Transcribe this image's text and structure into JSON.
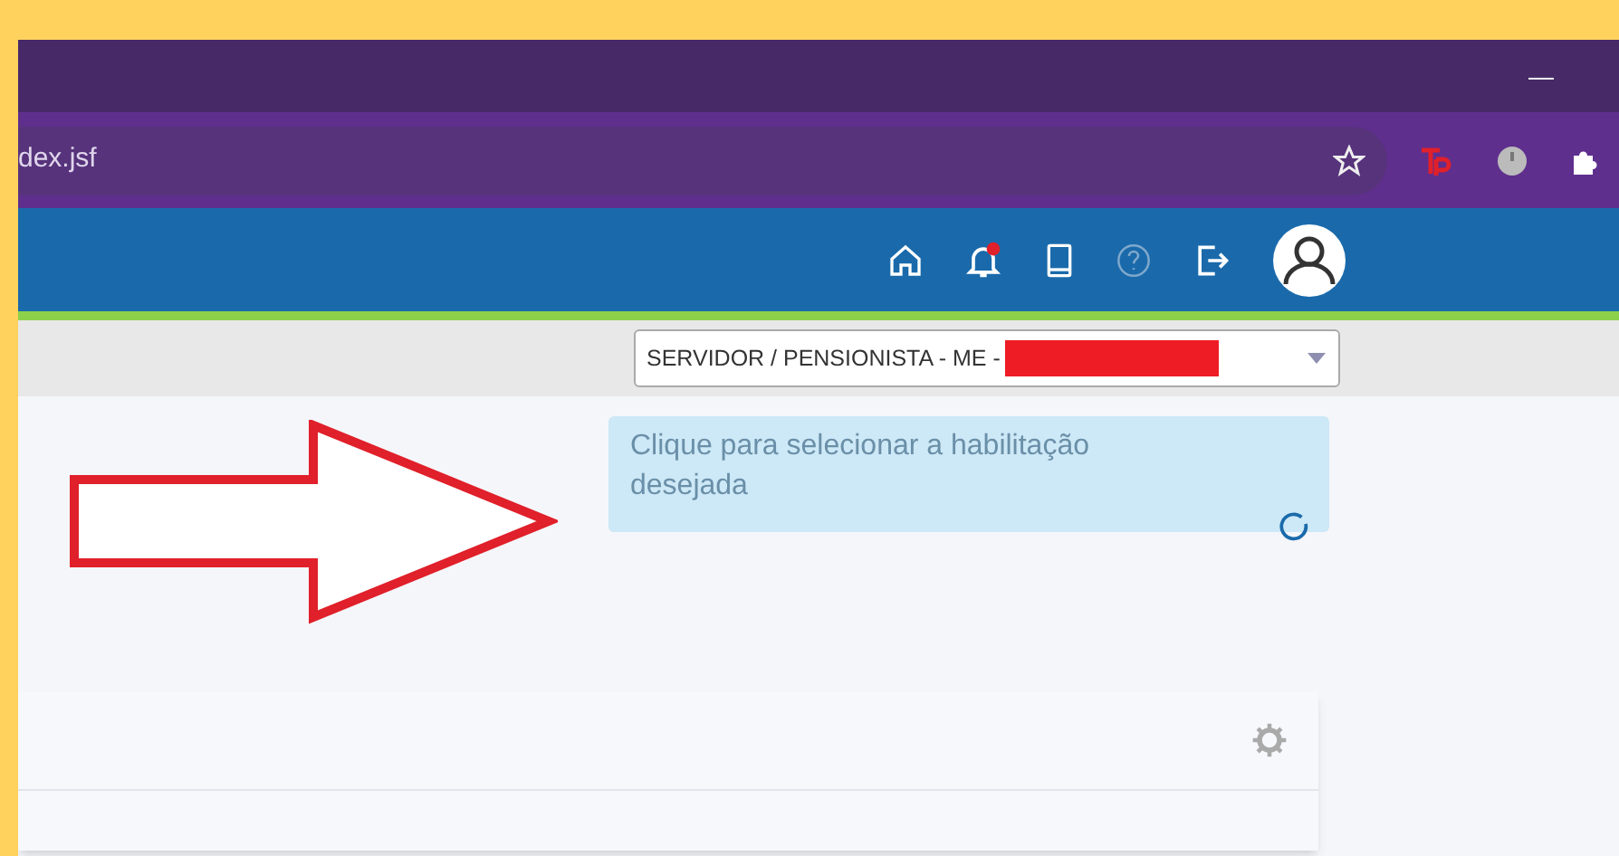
{
  "browser": {
    "address": "dex.jsf",
    "minimize": "—"
  },
  "profile_select": {
    "value": "SERVIDOR / PENSIONISTA - ME -"
  },
  "tooltip": {
    "text": "Clique para selecionar a habilitação desejada"
  },
  "notifications": {
    "unread": true
  }
}
